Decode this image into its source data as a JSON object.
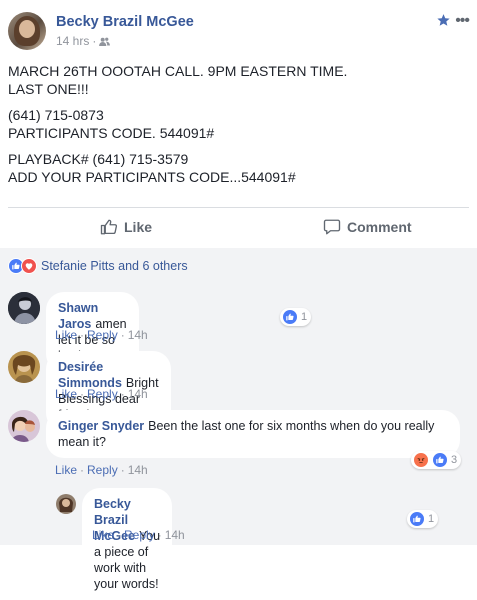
{
  "post": {
    "author": "Becky Brazil McGee",
    "time": "14 hrs",
    "separator": "·",
    "lines": [
      "MARCH 26TH OOOTAH CALL. 9PM EASTERN TIME.",
      "LAST ONE!!!",
      "(641) 715-0873",
      "PARTICIPANTS CODE. 544091#",
      "PLAYBACK# (641) 715-3579",
      "ADD YOUR PARTICIPANTS CODE...544091#"
    ],
    "actions": {
      "like": "Like",
      "comment": "Comment"
    },
    "reactions_summary": "Stefanie Pitts and 6 others"
  },
  "comments": [
    {
      "name": "Shawn Jaros",
      "text": "amen let it be so becky",
      "like": "Like",
      "reply": "Reply",
      "time": "14h",
      "reaction_count": "1"
    },
    {
      "name": "Desirée Simmonds",
      "text": "Bright Blessings dear friends.",
      "like": "Like",
      "reply": "Reply",
      "time": "14h"
    },
    {
      "name": "Ginger Snyder",
      "text": "Been the last one for six months when do you really mean it?",
      "like": "Like",
      "reply": "Reply",
      "time": "14h",
      "reaction_count": "3"
    },
    {
      "name": "Becky Brazil McGee",
      "text": "You a piece of work with your words!",
      "like": "Like",
      "reply": "Reply",
      "time": "14h",
      "reaction_count": "1"
    }
  ],
  "colors": {
    "link": "#385898",
    "meta": "#90949c",
    "comments_bg": "#f2f3f5",
    "like_blue": "#4a7bf7",
    "love_red": "#f0524f"
  },
  "icons": [
    "friends-icon",
    "star-icon",
    "more-icon",
    "thumbs-up-icon",
    "comment-icon",
    "like-reaction-icon",
    "love-reaction-icon",
    "angry-reaction-icon"
  ]
}
